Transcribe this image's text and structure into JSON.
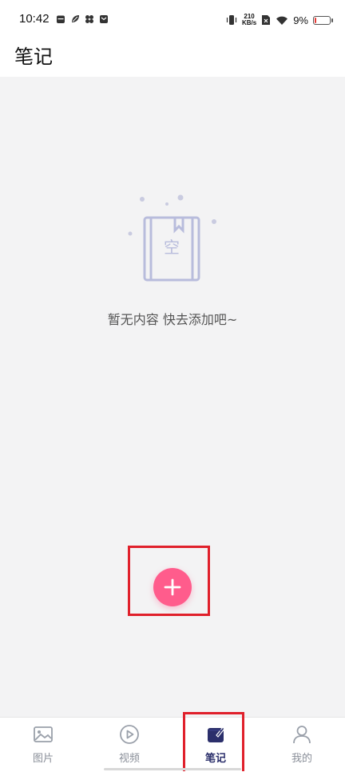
{
  "status_bar": {
    "time": "10:42",
    "speed_top": "210",
    "speed_bottom": "KB/s",
    "battery_percent": "9%",
    "battery_level": 0.09
  },
  "header": {
    "title": "笔记"
  },
  "main": {
    "empty_icon_char": "空",
    "empty_text": "暂无内容 快去添加吧~"
  },
  "fab": {
    "icon": "plus-icon",
    "color": "#ff5c8c"
  },
  "tabs": [
    {
      "label": "图片",
      "icon": "image-icon"
    },
    {
      "label": "视频",
      "icon": "play-icon"
    },
    {
      "label": "笔记",
      "icon": "notebook-icon",
      "active": true
    },
    {
      "label": "我的",
      "icon": "person-icon"
    }
  ],
  "colors": {
    "accent": "#ff5c8c",
    "active_tab": "#2b2f6b",
    "highlight": "#e0202b"
  }
}
